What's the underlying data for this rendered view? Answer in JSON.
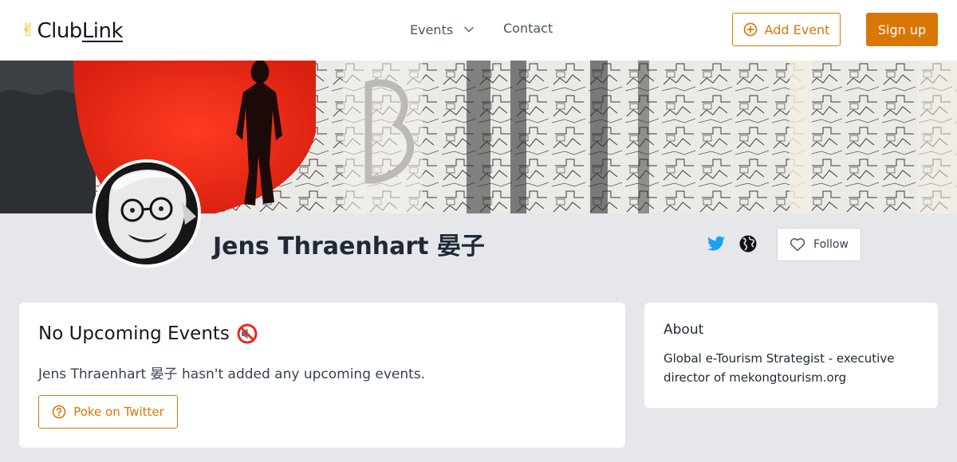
{
  "header": {
    "logo": {
      "emoji": "✌",
      "part1": "Club",
      "part2": "Link"
    },
    "nav": {
      "events_label": "Events",
      "contact_label": "Contact"
    },
    "add_event_label": "Add Event",
    "signup_label": "Sign up"
  },
  "profile": {
    "name": "Jens Thraenhart 晏子",
    "follow_label": "Follow",
    "icons": [
      "twitter-icon",
      "globe-icon",
      "heart-icon"
    ]
  },
  "events_card": {
    "title": "No Upcoming Events",
    "title_icon": "mute-icon",
    "message": "Jens Thraenhart 晏子 hasn't added any upcoming events.",
    "poke_label": "Poke on Twitter"
  },
  "about_card": {
    "title": "About",
    "text": "Global e-Tourism Strategist - executive director of mekongtourism.org"
  },
  "colors": {
    "accent": "#d97706",
    "page_bg": "#e5e7eb",
    "twitter": "#1da1f2",
    "heart_red": "#e8291c"
  }
}
